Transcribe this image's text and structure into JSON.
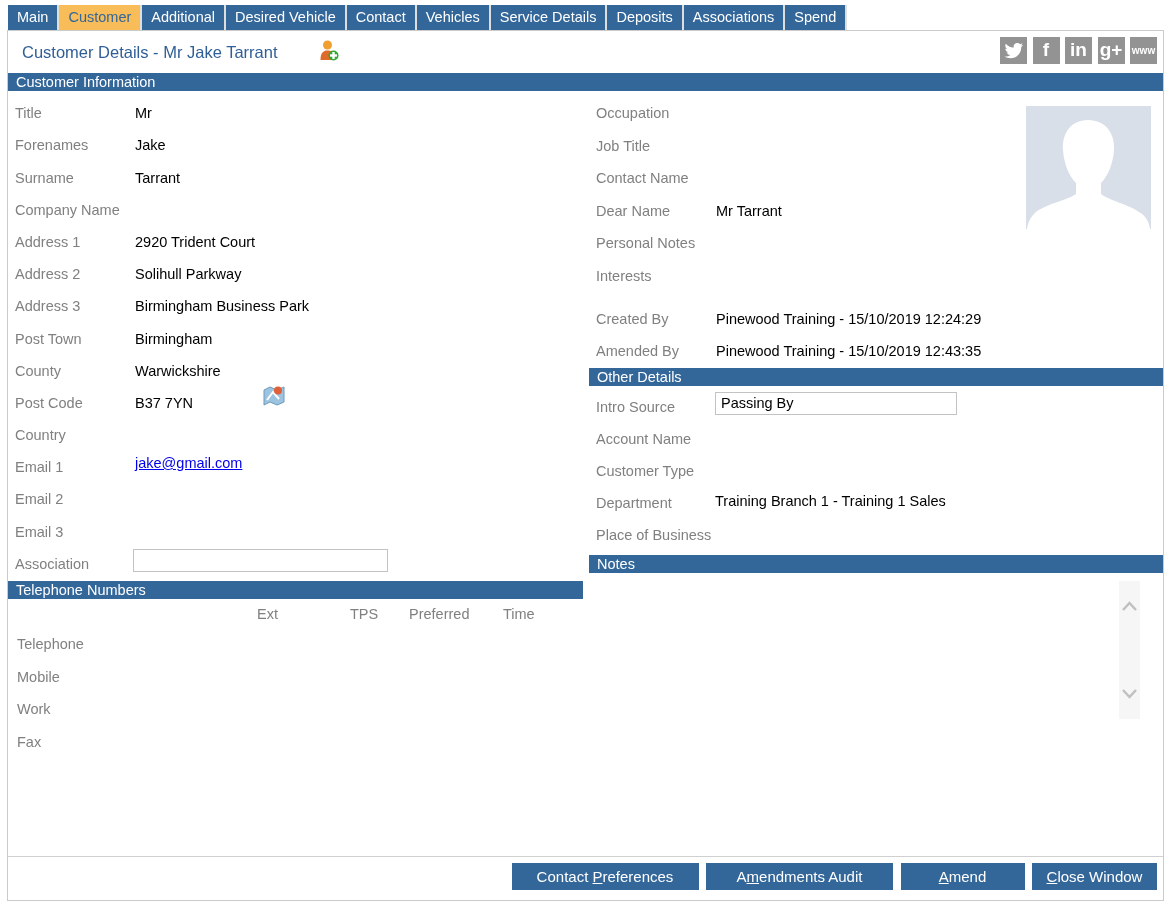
{
  "tabs": [
    {
      "label": "Main",
      "selected": false
    },
    {
      "label": "Customer",
      "selected": true
    },
    {
      "label": "Additional",
      "selected": false
    },
    {
      "label": "Desired Vehicle",
      "selected": false
    },
    {
      "label": "Contact",
      "selected": false
    },
    {
      "label": "Vehicles",
      "selected": false
    },
    {
      "label": "Service Details",
      "selected": false
    },
    {
      "label": "Deposits",
      "selected": false
    },
    {
      "label": "Associations",
      "selected": false
    },
    {
      "label": "Spend",
      "selected": false
    }
  ],
  "header": {
    "title": "Customer Details - Mr Jake Tarrant",
    "share_links": [
      {
        "kind": "bird"
      },
      {
        "kind": "letters",
        "text": "f"
      },
      {
        "kind": "letters",
        "text": "in"
      },
      {
        "kind": "letters",
        "text": "g+"
      },
      {
        "kind": "letters",
        "text": "www"
      }
    ]
  },
  "customer_information": {
    "title": "Customer Information",
    "left_fields": [
      {
        "label": "Title",
        "kind": "text",
        "value": "Mr"
      },
      {
        "label": "Forenames",
        "kind": "text",
        "value": "Jake"
      },
      {
        "label": "Surname",
        "kind": "text",
        "value": "Tarrant"
      },
      {
        "label": "Company Name",
        "kind": "text"
      },
      {
        "label": "Address 1",
        "kind": "text",
        "value": "2920 Trident Court"
      },
      {
        "label": "Address 2",
        "kind": "text",
        "value": "Solihull Parkway"
      },
      {
        "label": "Address 3",
        "kind": "text",
        "value": "Birmingham Business Park"
      },
      {
        "label": "Post Town",
        "kind": "text",
        "value": "Birmingham"
      },
      {
        "label": "County",
        "kind": "text",
        "value": "Warwickshire"
      },
      {
        "label": "Post Code",
        "kind": "map",
        "value": "B37 7YN"
      },
      {
        "label": "Country",
        "kind": "text"
      },
      {
        "label": "Email 1",
        "kind": "link",
        "value": "jake@gmail.com"
      },
      {
        "label": "Email 2",
        "kind": "text"
      },
      {
        "label": "Email 3",
        "kind": "text"
      },
      {
        "label": "Association",
        "kind": "input"
      }
    ],
    "right_fields": [
      {
        "label": "Occupation",
        "kind": "text"
      },
      {
        "label": "Job Title",
        "kind": "text"
      },
      {
        "label": "Contact Name",
        "kind": "text"
      },
      {
        "label": "Dear Name",
        "kind": "text",
        "value": "Mr Tarrant"
      },
      {
        "label": "Personal Notes",
        "kind": "text"
      },
      {
        "label": "Interests",
        "kind": "text"
      }
    ],
    "audit_fields": [
      {
        "label": "Created By",
        "kind": "text",
        "value": "Pinewood Training - 15/10/2019 12:24:29"
      },
      {
        "label": "Amended By",
        "kind": "text",
        "value": "Pinewood Training - 15/10/2019 12:43:35"
      }
    ]
  },
  "telephone_numbers": {
    "title": "Telephone Numbers",
    "columns": [
      "Ext",
      "TPS",
      "Preferred",
      "Time"
    ],
    "rows": [
      {
        "label": "Telephone"
      },
      {
        "label": "Mobile"
      },
      {
        "label": "Work"
      },
      {
        "label": "Fax"
      }
    ]
  },
  "other_details": {
    "title": "Other Details",
    "fields": [
      {
        "label": "Intro Source",
        "kind": "input",
        "value": "Passing By"
      },
      {
        "label": "Account Name",
        "kind": "text"
      },
      {
        "label": "Customer Type",
        "kind": "text"
      },
      {
        "label": "Department",
        "kind": "text",
        "value": "Training Branch 1 - Training 1 Sales"
      },
      {
        "label": "Place of Business",
        "kind": "text"
      }
    ]
  },
  "notes": {
    "title": "Notes"
  },
  "buttons": [
    {
      "before": "Contact ",
      "mnemonic": "P",
      "after": "references"
    },
    {
      "before": "A",
      "mnemonic": "m",
      "after": "endments Audit"
    },
    {
      "mnemonic": "A",
      "after": "mend"
    },
    {
      "mnemonic": "C",
      "after": "lose Window"
    }
  ]
}
